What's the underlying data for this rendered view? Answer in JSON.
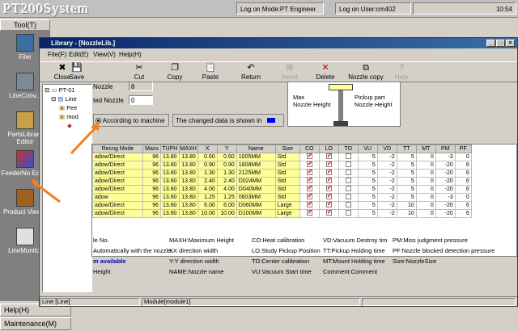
{
  "app": {
    "title": "PT200System",
    "login_mode": "Log on Mode:PT Engineer",
    "login_user": "Log on User:cm402",
    "datetime": "10:54"
  },
  "left_panel": {
    "tool_label": "Tool(T)",
    "tools": [
      {
        "label": "Filer",
        "icon": "filer-icon"
      },
      {
        "label": "LineConv...",
        "icon": "line-conv-icon"
      },
      {
        "label": "PartsLibrary Editor",
        "icon": "parts-library-icon"
      },
      {
        "label": "FeederNo Editor",
        "icon": "feeder-icon"
      },
      {
        "label": "Product Viewer",
        "icon": "product-viewer-icon"
      },
      {
        "label": "LineMonitor",
        "icon": "line-monitor-icon"
      }
    ],
    "help_label": "Help(H)",
    "maintenance_label": "Maintenance(M)"
  },
  "window": {
    "title": "Library - [NozzleLib.]",
    "menus": [
      "File(F)",
      "Edit(E)",
      "View(V)",
      "Help(H)"
    ],
    "toolbar": [
      {
        "label": "Close",
        "glyph": "✖",
        "enabled": true
      },
      {
        "label": "Save",
        "glyph": "💾",
        "enabled": true
      },
      {
        "label": "Cut",
        "glyph": "✂",
        "enabled": true
      },
      {
        "label": "Copy",
        "glyph": "❐",
        "enabled": true
      },
      {
        "label": "Paste",
        "glyph": "📋",
        "enabled": true
      },
      {
        "label": "Return",
        "glyph": "↶",
        "enabled": true
      },
      {
        "label": "Insert",
        "glyph": "⊞",
        "enabled": false
      },
      {
        "label": "Delete",
        "glyph": "✕",
        "enabled": true
      },
      {
        "label": "Nozzle copy",
        "glyph": "⧉",
        "enabled": true
      },
      {
        "label": "Help",
        "glyph": "?",
        "enabled": false
      }
    ]
  },
  "tree": [
    "PT-01",
    "Line",
    "Fee",
    "mod"
  ],
  "form": {
    "nozzle_label": "Nozzle",
    "nozzle_value": "8",
    "selected_label": "ted Nozzle",
    "selected_value": "0",
    "radio_label": "According to machine",
    "changed_text": "The changed data is shown in",
    "changed_color": "#0000ff",
    "diagram_max": "Max\nNozzle Height",
    "diagram_pickup": "Pickup part\nNozzle Height"
  },
  "table": {
    "columns": [
      "Recog Mode",
      "Maxs",
      "TUPH",
      "MAXH",
      "X",
      "Y",
      "Name",
      "Size",
      "CO",
      "LO",
      "TO",
      "VU",
      "VD",
      "TT",
      "MT",
      "PM",
      "PF"
    ],
    "rows": [
      [
        "adow/Direct",
        "96",
        "13.80",
        "13.80",
        "0.60",
        "0.60",
        "1005MM",
        "Std",
        true,
        true,
        false,
        "5",
        "-2",
        "5",
        "0",
        "-3",
        "0"
      ],
      [
        "adow/Direct",
        "96",
        "13.80",
        "13.80",
        "0.90",
        "0.90",
        "1608MM",
        "Std",
        true,
        true,
        false,
        "5",
        "-2",
        "5",
        "0",
        "-20",
        "6"
      ],
      [
        "adow/Direct",
        "96",
        "13.80",
        "13.80",
        "1.30",
        "1.30",
        "2125MM",
        "Std",
        true,
        true,
        false,
        "5",
        "-2",
        "5",
        "0",
        "-20",
        "6"
      ],
      [
        "adow/Direct",
        "96",
        "13.80",
        "13.80",
        "2.40",
        "2.40",
        "D024MM",
        "Std",
        true,
        true,
        false,
        "5",
        "-2",
        "5",
        "0",
        "-20",
        "6"
      ],
      [
        "adow/Direct",
        "96",
        "13.80",
        "13.80",
        "4.00",
        "4.00",
        "D040MM",
        "Std",
        true,
        true,
        false,
        "5",
        "-2",
        "5",
        "0",
        "-20",
        "6"
      ],
      [
        "adow",
        "96",
        "13.80",
        "13.80",
        "1.25",
        "1.25",
        "0603MM",
        "Std",
        true,
        true,
        false,
        "5",
        "-2",
        "5",
        "0",
        "-3",
        "0"
      ],
      [
        "adow/Direct",
        "96",
        "13.80",
        "13.80",
        "6.00",
        "6.00",
        "D060MM",
        "Large",
        true,
        true,
        false,
        "5",
        "-2",
        "10",
        "0",
        "-20",
        "6"
      ],
      [
        "adow/Direct",
        "96",
        "13.80",
        "13.80",
        "10.00",
        "10.00",
        "D100MM",
        "Large",
        true,
        true,
        false,
        "5",
        "-2",
        "10",
        "0",
        "-20",
        "6"
      ]
    ]
  },
  "legend": [
    "le No.",
    "MAXH:Maximum Height",
    "CO:Heat calibration",
    "VD:Vacuum Destroy tim",
    "PM:Miss judgment pressure",
    "Automatically with the nozzle.",
    "XX direction width",
    "LO:Study Pickup Position",
    "TT:Pickup Holding time",
    "PF:Nozzle blocked detection pressure",
    "m available",
    "Y:Y direction width",
    "TO:Center calibration",
    "MT:Mount Holding time",
    "Size:NozzleSize",
    "Height",
    "NAME:Nozzle name",
    "VU:Vacuum Start time",
    "Comment:Comment"
  ],
  "status": {
    "line": "Line [Line]",
    "module": "Module[module1]"
  }
}
